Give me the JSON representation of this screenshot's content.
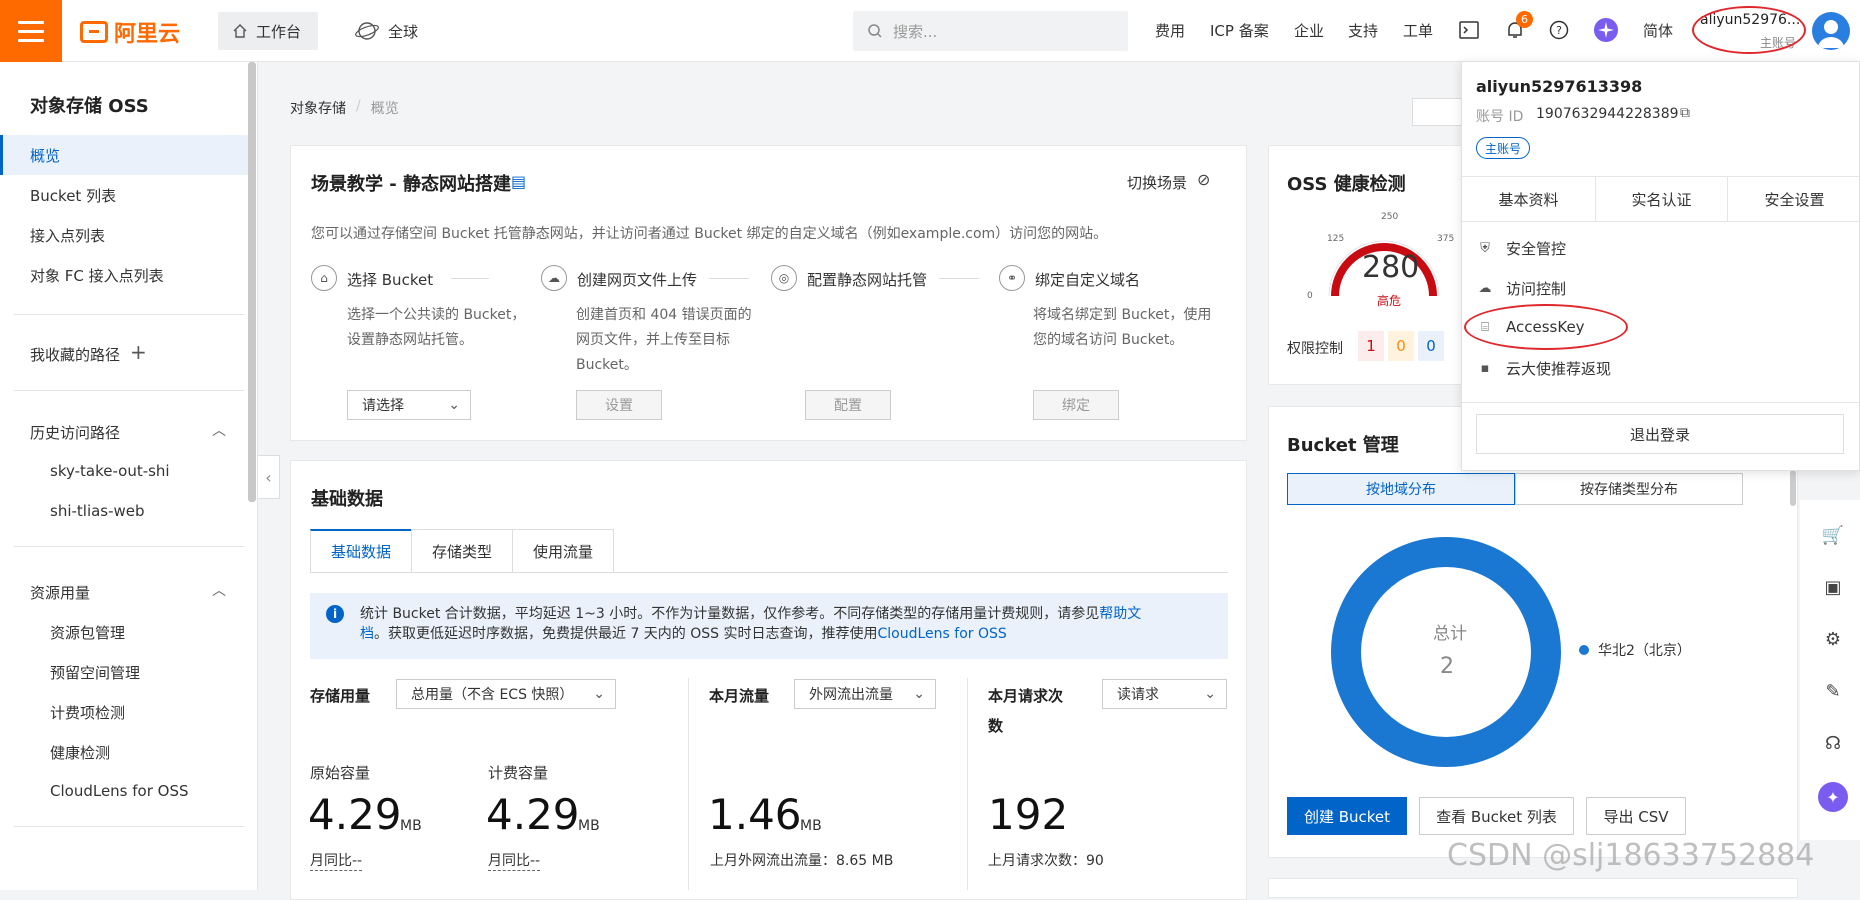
{
  "brand": {
    "name": "阿里云",
    "accent": "#ff6a00",
    "primary": "#0064c8"
  },
  "topbar": {
    "workbench": "工作台",
    "global": "全球",
    "search_placeholder": "搜索...",
    "links": [
      "费用",
      "ICP 备案",
      "企业",
      "支持",
      "工单"
    ],
    "notification_count": "6",
    "lang": "简体",
    "user_short": "aliyun52976...",
    "user_role": "主账号"
  },
  "sidebar": {
    "title": "对象存储 OSS",
    "items": [
      "概览",
      "Bucket 列表",
      "接入点列表",
      "对象 FC 接入点列表"
    ],
    "favorites": "我收藏的路径",
    "history_title": "历史访问路径",
    "history": [
      "sky-take-out-shi",
      "shi-tlias-web"
    ],
    "usage_title": "资源用量",
    "usage": [
      "资源包管理",
      "预留空间管理",
      "计费项检测",
      "健康检测",
      "CloudLens for OSS"
    ]
  },
  "breadcrumb": {
    "root": "对象存储",
    "sep": "/",
    "current": "概览"
  },
  "scene": {
    "title": "场景教学 - 静态网站搭建",
    "switch": "切换场景",
    "desc": "您可以通过存储空间 Bucket 托管静态网站，并让访问者通过 Bucket 绑定的自定义域名（例如example.com）访问您的网站。",
    "steps": [
      {
        "title": "选择 Bucket",
        "desc1": "选择一个公共读的 Bucket，",
        "desc2": "设置静态网站托管。",
        "desc3": "",
        "action": "请选择"
      },
      {
        "title": "创建网页文件上传",
        "desc1": "创建首页和 404 错误页面的",
        "desc2": "网页文件，并上传至目标",
        "desc3": "Bucket。",
        "action": "设置"
      },
      {
        "title": "配置静态网站托管",
        "desc1": "",
        "desc2": "",
        "desc3": "",
        "action": "配置"
      },
      {
        "title": "绑定自定义域名",
        "desc1": "将域名绑定到 Bucket，使用",
        "desc2": "您的域名访问 Bucket。",
        "desc3": "",
        "action": "绑定"
      }
    ]
  },
  "basic": {
    "title": "基础数据",
    "tabs": [
      "基础数据",
      "存储类型",
      "使用流量"
    ],
    "info_a": "统计 Bucket 合计数据，平均延迟 1~3 小时。不作为计量数据，仅作参考。不同存储类型的存储用量计费规则，请参见",
    "info_link1a": "帮助文",
    "info_link1b": "档",
    "info_b": "。获取更低延迟时序数据，免费提供最近 7 天内的 OSS 实时日志查询，推荐使用",
    "info_link2": "CloudLens for OSS",
    "storage_label": "存储用量",
    "storage_select": "总用量（不含 ECS 快照）",
    "traffic_label": "本月流量",
    "traffic_select": "外网流出流量",
    "req_label1": "本月请求次",
    "req_label2": "数",
    "req_select": "读请求",
    "raw_label": "原始容量",
    "raw_value": "4.29",
    "raw_unit": "MB",
    "raw_cmp": "月同比--",
    "bill_label": "计费容量",
    "bill_value": "4.29",
    "bill_unit": "MB",
    "bill_cmp": "月同比--",
    "traffic_value": "1.46",
    "traffic_unit": "MB",
    "traffic_last": "上月外网流出流量：8.65 MB",
    "req_value": "192",
    "req_last": "上月请求次数：90"
  },
  "health": {
    "title": "OSS 健康检测",
    "score": "280",
    "level": "高危",
    "ticks": [
      "0",
      "125",
      "250",
      "375"
    ],
    "perm_label": "权限控制",
    "perm_counts": [
      "1",
      "0",
      "0"
    ]
  },
  "bucket_mgmt": {
    "title": "Bucket 管理",
    "tabs": [
      "按地域分布",
      "按存储类型分布"
    ],
    "total_label": "总计",
    "total_value": "2",
    "legend": "华北2（北京）",
    "chart_color": "#1a77d2",
    "buttons": [
      "创建 Bucket",
      "查看 Bucket 列表",
      "导出 CSV"
    ]
  },
  "chart_data": {
    "type": "pie",
    "categories": [
      "华北2（北京）"
    ],
    "values": [
      2
    ],
    "title": "",
    "total": 2
  },
  "account_menu": {
    "name": "aliyun5297613398",
    "id_label": "账号 ID",
    "id_value": "1907632944228389",
    "badge": "主账号",
    "tabs": [
      "基本资料",
      "实名认证",
      "安全设置"
    ],
    "items": [
      "安全管控",
      "访问控制",
      "AccessKey",
      "云大使推荐返现"
    ],
    "logout": "退出登录"
  },
  "watermark": "CSDN @slj18633752884"
}
